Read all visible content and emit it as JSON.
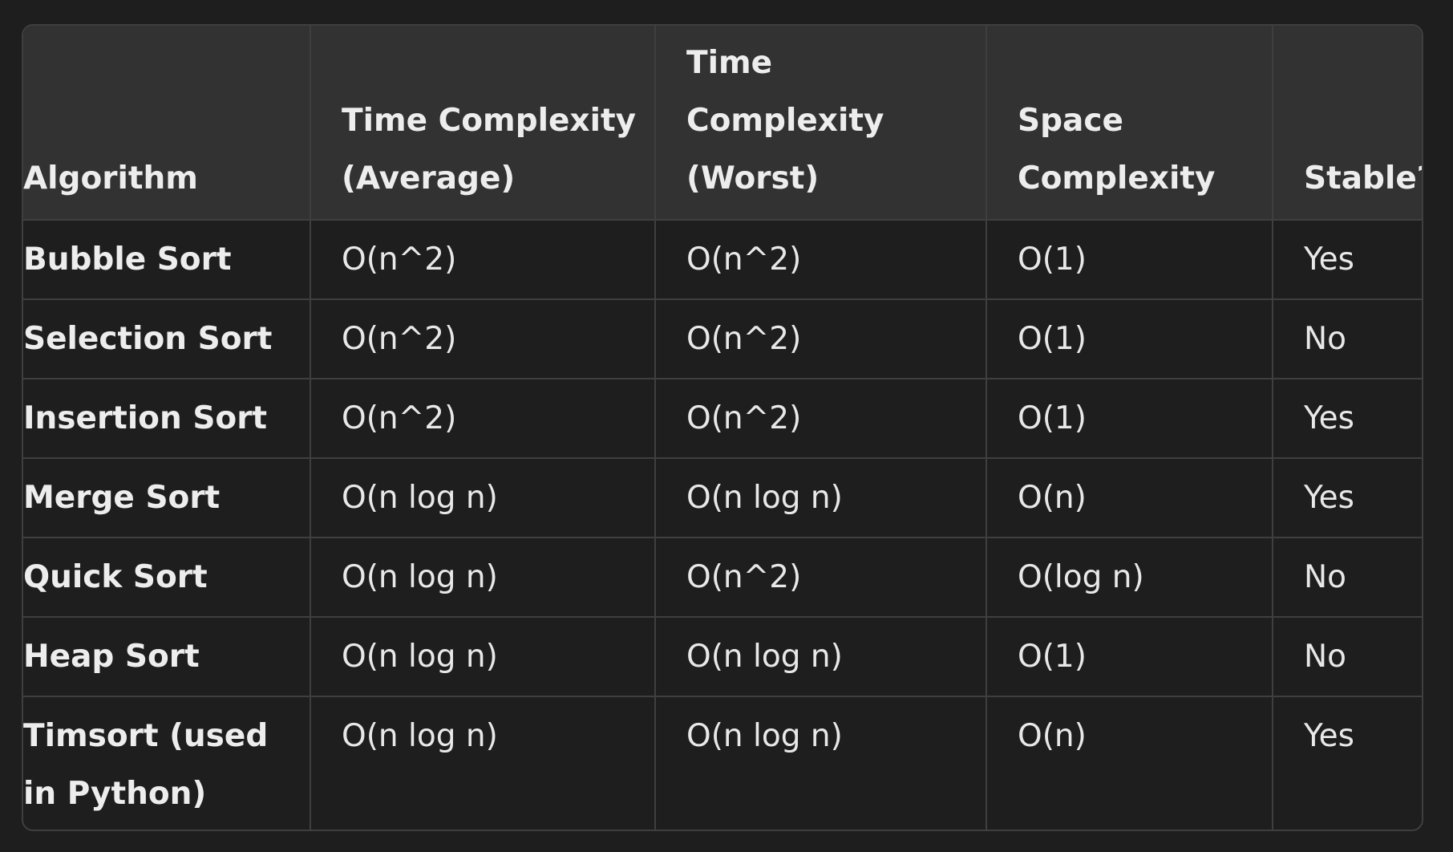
{
  "table": {
    "headers": [
      "Algorithm",
      "Time Complexity (Average)",
      "Time Complexity (Worst)",
      "Space Complexity",
      "Stable?"
    ],
    "rows": [
      [
        "Bubble Sort",
        "O(n^2)",
        "O(n^2)",
        "O(1)",
        "Yes"
      ],
      [
        "Selection Sort",
        "O(n^2)",
        "O(n^2)",
        "O(1)",
        "No"
      ],
      [
        "Insertion Sort",
        "O(n^2)",
        "O(n^2)",
        "O(1)",
        "Yes"
      ],
      [
        "Merge Sort",
        "O(n log n)",
        "O(n log n)",
        "O(n)",
        "Yes"
      ],
      [
        "Quick Sort",
        "O(n log n)",
        "O(n^2)",
        "O(log n)",
        "No"
      ],
      [
        "Heap Sort",
        "O(n log n)",
        "O(n log n)",
        "O(1)",
        "No"
      ],
      [
        "Timsort (used in Python)",
        "O(n log n)",
        "O(n log n)",
        "O(n)",
        "Yes"
      ]
    ]
  }
}
